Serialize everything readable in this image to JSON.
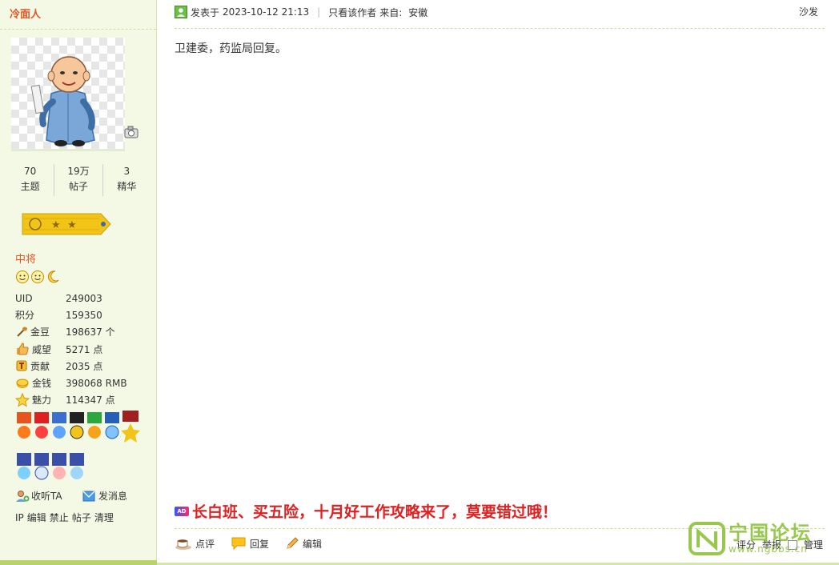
{
  "author": {
    "name": "冷面人",
    "stats": [
      {
        "value": "70",
        "label": "主题"
      },
      {
        "value": "19万",
        "label": "帖子"
      },
      {
        "value": "3",
        "label": "精华"
      }
    ],
    "rank_title": "中将",
    "info": [
      {
        "label": "UID",
        "value": "249003",
        "icon": ""
      },
      {
        "label": "积分",
        "value": "159350",
        "icon": ""
      },
      {
        "label": "金豆",
        "value": "198637 个",
        "icon": "bean-icon"
      },
      {
        "label": "威望",
        "value": "5271 点",
        "icon": "thumb-up-icon"
      },
      {
        "label": "贡献",
        "value": "2035 点",
        "icon": "contribution-icon"
      },
      {
        "label": "金钱",
        "value": "398068 RMB",
        "icon": "gold-ingot-icon"
      },
      {
        "label": "魅力",
        "value": "114347 点",
        "icon": "star-icon"
      }
    ],
    "follow_label": "收听TA",
    "message_label": "发消息",
    "ip_actions": [
      "IP",
      "编辑",
      "禁止",
      "帖子",
      "清理"
    ]
  },
  "post": {
    "posted_label": "发表于",
    "date": "2023-10-12 21:13",
    "only_author": "只看该作者",
    "from_label": "来自:",
    "location": "安徽",
    "floor": "沙发",
    "content": "卫建委，药监局回复。",
    "ad_tag": "AD",
    "ad_text": "长白班、买五险，十月好工作攻略来了，莫要错过哦！",
    "actions": [
      "点评",
      "回复",
      "编辑"
    ],
    "right_actions": [
      "评分",
      "举报",
      "管理"
    ]
  },
  "watermark": {
    "name": "宁国论坛",
    "url": "www.ngbbs.cn"
  },
  "colors": {
    "accent": "#e8541e",
    "sidebar_bg": "#f4f9e6",
    "ad_red": "#e02020",
    "watermark_green": "#8dc23a"
  }
}
